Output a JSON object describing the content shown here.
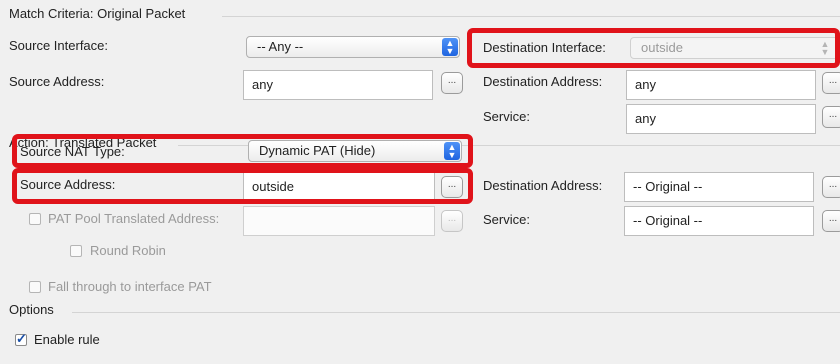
{
  "match": {
    "title": "Match Criteria: Original Packet",
    "source_interface": {
      "label": "Source Interface:",
      "value": "-- Any --"
    },
    "source_address": {
      "label": "Source Address:",
      "value": "any"
    },
    "dest_interface": {
      "label": "Destination Interface:",
      "value": "outside"
    },
    "dest_address": {
      "label": "Destination Address:",
      "value": "any"
    },
    "service": {
      "label": "Service:",
      "value": "any"
    }
  },
  "action": {
    "title": "Action: Translated Packet",
    "source_nat_type": {
      "label": "Source NAT Type:",
      "value": "Dynamic PAT (Hide)"
    },
    "source_address": {
      "label": "Source Address:",
      "value": "outside"
    },
    "pat_pool": {
      "label": "PAT Pool Translated Address:",
      "value": ""
    },
    "round_robin": {
      "label": "Round Robin"
    },
    "dest_address": {
      "label": "Destination Address:",
      "value": "-- Original --"
    },
    "service": {
      "label": "Service:",
      "value": "-- Original --"
    },
    "fall_through": {
      "label": "Fall through to interface PAT"
    }
  },
  "options": {
    "title": "Options",
    "enable_rule": {
      "label": "Enable rule",
      "checked": true
    }
  },
  "browse_button_label": "...",
  "colors": {
    "highlight": "#e0131a",
    "stepper": "#2f74ee"
  }
}
